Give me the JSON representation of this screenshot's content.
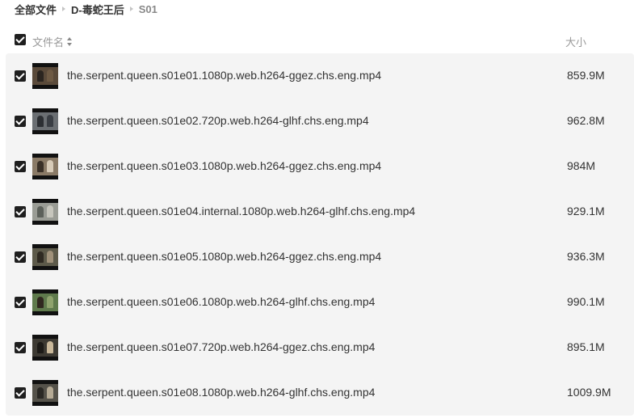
{
  "breadcrumb": {
    "items": [
      "全部文件",
      "D-毒蛇王后",
      "S01"
    ]
  },
  "header": {
    "name_label": "文件名",
    "size_label": "大小"
  },
  "files": [
    {
      "name": "the.serpent.queen.s01e01.1080p.web.h264-ggez.chs.eng.mp4",
      "size": "859.9M",
      "thumb_bg": "#5a4a3a",
      "thumb_a": "#2b2520",
      "thumb_b": "#6e5a44"
    },
    {
      "name": "the.serpent.queen.s01e02.720p.web.h264-glhf.chs.eng.mp4",
      "size": "962.8M",
      "thumb_bg": "#6b6f73",
      "thumb_a": "#2c2f33",
      "thumb_b": "#3a3e44"
    },
    {
      "name": "the.serpent.queen.s01e03.1080p.web.h264-ggez.chs.eng.mp4",
      "size": "984M",
      "thumb_bg": "#8a7a66",
      "thumb_a": "#3b3128",
      "thumb_b": "#d8cbb8"
    },
    {
      "name": "the.serpent.queen.s01e04.internal.1080p.web.h264-glhf.chs.eng.mp4",
      "size": "929.1M",
      "thumb_bg": "#9a9c95",
      "thumb_a": "#5c605a",
      "thumb_b": "#c7c6bd"
    },
    {
      "name": "the.serpent.queen.s01e05.1080p.web.h264-ggez.chs.eng.mp4",
      "size": "936.3M",
      "thumb_bg": "#5d5a4a",
      "thumb_a": "#2f2a22",
      "thumb_b": "#a0917a"
    },
    {
      "name": "the.serpent.queen.s01e06.1080p.web.h264-glhf.chs.eng.mp4",
      "size": "990.1M",
      "thumb_bg": "#5f7a4c",
      "thumb_a": "#30281f",
      "thumb_b": "#8fa36d"
    },
    {
      "name": "the.serpent.queen.s01e07.720p.web.h264-ggez.chs.eng.mp4",
      "size": "895.1M",
      "thumb_bg": "#3d3a33",
      "thumb_a": "#1c1a17",
      "thumb_b": "#c9b89a"
    },
    {
      "name": "the.serpent.queen.s01e08.1080p.web.h264-glhf.chs.eng.mp4",
      "size": "1009.9M",
      "thumb_bg": "#55524a",
      "thumb_a": "#2a2824",
      "thumb_b": "#b5aa95"
    }
  ]
}
